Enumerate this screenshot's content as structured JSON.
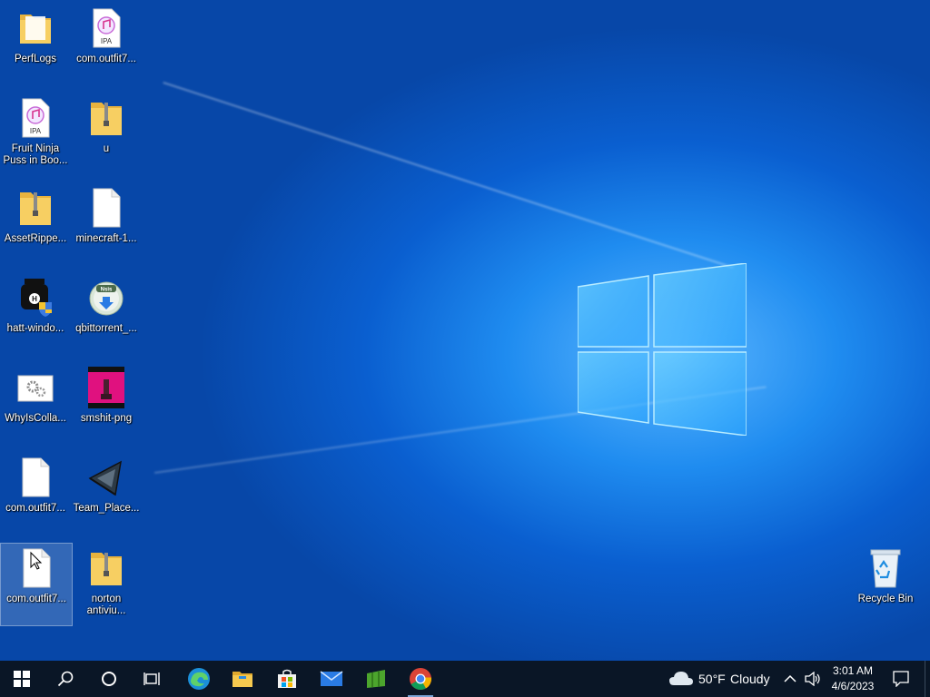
{
  "desktop": {
    "icons": [
      {
        "label": "PerfLogs",
        "type": "folder"
      },
      {
        "label": "com.outfit7...",
        "type": "ipa"
      },
      {
        "label": "Fruit Ninja Puss in Boo...",
        "type": "ipa"
      },
      {
        "label": "u",
        "type": "zip-folder"
      },
      {
        "label": "AssetRippe...",
        "type": "zip-folder"
      },
      {
        "label": "minecraft-1...",
        "type": "file"
      },
      {
        "label": "hatt-windo...",
        "type": "exe-shield"
      },
      {
        "label": "qbittorrent_...",
        "type": "installer"
      },
      {
        "label": "WhyIsColla...",
        "type": "settings"
      },
      {
        "label": "smshit-png",
        "type": "image"
      },
      {
        "label": "com.outfit7...",
        "type": "file"
      },
      {
        "label": "Team_Place...",
        "type": "app"
      },
      {
        "label": "com.outfit7...",
        "type": "file"
      },
      {
        "label": "norton antiviu...",
        "type": "zip-folder"
      }
    ],
    "ipa_badge": "IPA",
    "qbit_badge": "Nsis",
    "recycle_bin": {
      "label": "Recycle Bin"
    }
  },
  "taskbar": {
    "buttons": [
      {
        "name": "start-button",
        "icon": "windows-icon"
      },
      {
        "name": "search-button",
        "icon": "search-icon"
      },
      {
        "name": "cortana-button",
        "icon": "cortana-circle-icon"
      },
      {
        "name": "task-view-button",
        "icon": "task-view-icon"
      },
      {
        "name": "edge-button",
        "icon": "edge-icon"
      },
      {
        "name": "file-explorer-button",
        "icon": "folder-icon"
      },
      {
        "name": "store-button",
        "icon": "store-icon"
      },
      {
        "name": "mail-button",
        "icon": "mail-icon"
      },
      {
        "name": "minecraft-button",
        "icon": "green-app-icon"
      },
      {
        "name": "chrome-button",
        "icon": "chrome-icon"
      }
    ],
    "weather": {
      "temp": "50°F",
      "condition": "Cloudy"
    },
    "clock": {
      "time": "3:01 AM",
      "date": "4/6/2023"
    }
  },
  "colors": {
    "taskbar": "#0a1626",
    "desktop_accent": "#1f8cf0",
    "folder": "#f5c453"
  }
}
